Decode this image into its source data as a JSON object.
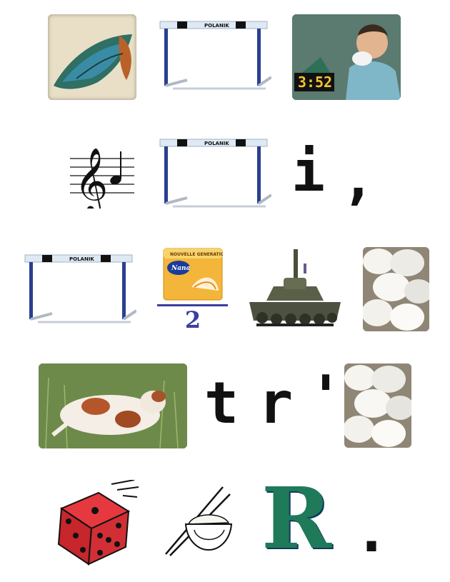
{
  "row1": {
    "items": [
      "wing",
      "hurdle",
      "man-sneezing-clock"
    ],
    "clock": "3:52"
  },
  "row2": {
    "items": [
      "treble-clef",
      "hurdle",
      "letter-i",
      "comma"
    ],
    "letter": "i",
    "punct": ","
  },
  "row3": {
    "items": [
      "hurdle",
      "pad-pack",
      "tank",
      "eggs"
    ],
    "pack_brand": "Nana",
    "pack_banner": "NOUVELLE GENERATION",
    "fraction_denominator": "2"
  },
  "row4": {
    "items": [
      "calf",
      "t",
      "r",
      "apostrophe",
      "eggs"
    ],
    "text_t": "t",
    "text_r": "r",
    "apostrophe": "'"
  },
  "row5": {
    "items": [
      "dice",
      "rice-bowl",
      "letter-R",
      "period"
    ],
    "big_letter": "R",
    "period": "."
  },
  "hurdle_brand": "POLANIK",
  "colors": {
    "hurdle_post": "#2a3f8f",
    "hurdle_bar": "#dfe9f3",
    "fraction": "#3a3f9f",
    "dice": "#d8262b",
    "r_green": "#1f7a5a"
  }
}
